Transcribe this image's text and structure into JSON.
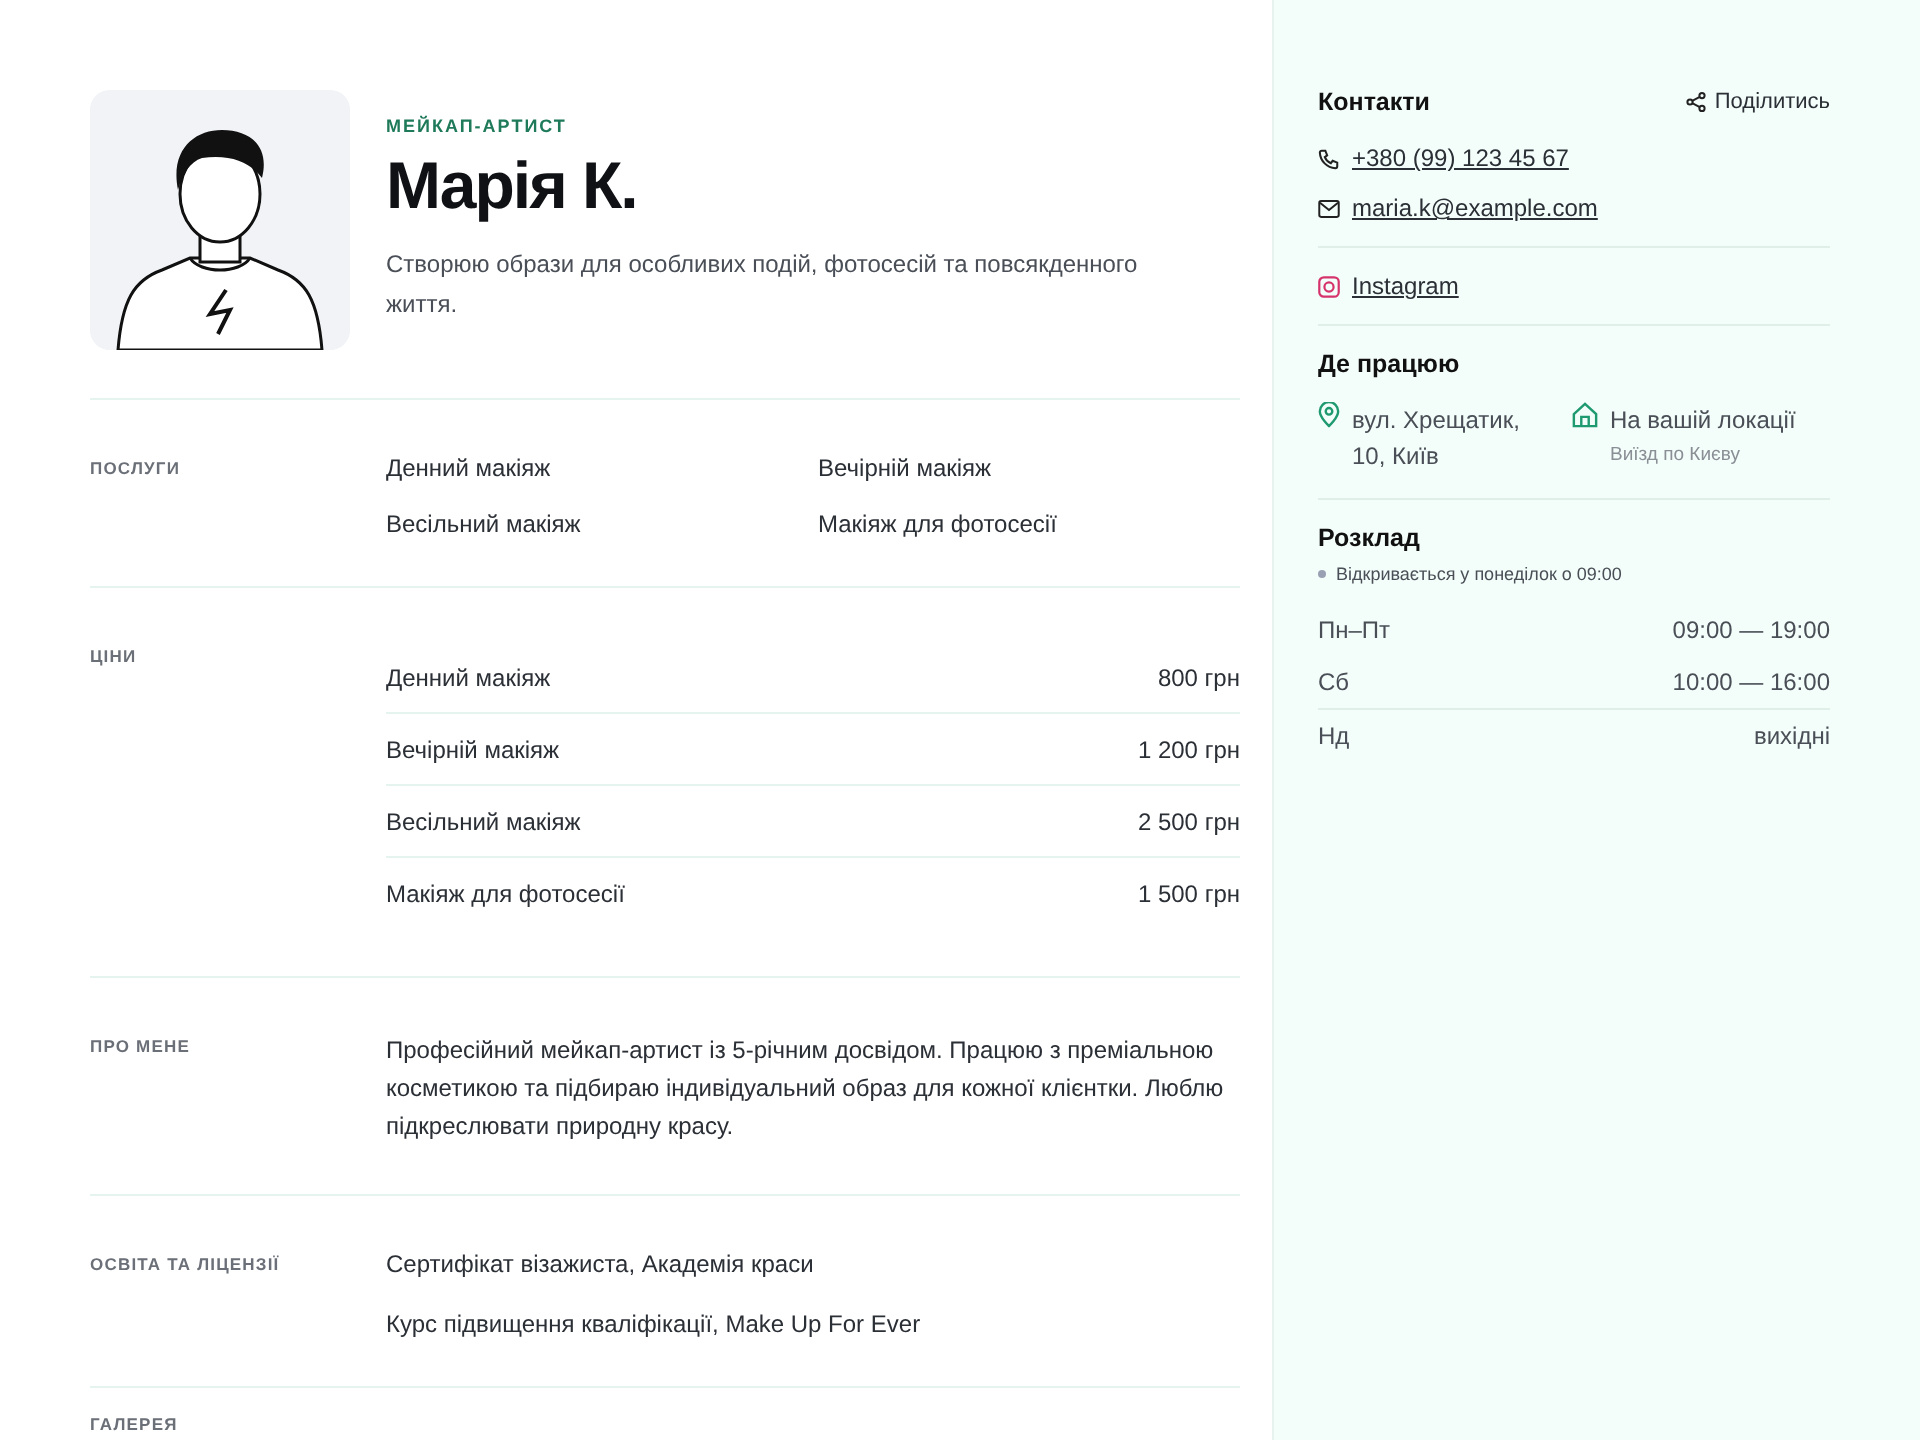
{
  "profile": {
    "role": "МЕЙКАП-АРТИСТ",
    "name": "Марія К.",
    "tagline": "Створюю образи для особливих подій, фотосесій та повсякденного життя."
  },
  "sections": [
    {
      "kind": "grid",
      "label": "ПОСЛУГИ",
      "items": [
        "Денний макіяж",
        "Вечірній макіяж",
        "Весільний макіяж",
        "Макіяж для фотосесії"
      ]
    },
    {
      "kind": "prices",
      "label": "ЦІНИ",
      "rows": [
        {
          "name": "Денний макіяж",
          "price": "800 грн"
        },
        {
          "name": "Вечірній макіяж",
          "price": "1 200 грн"
        },
        {
          "name": "Весільний макіяж",
          "price": "2 500 грн"
        },
        {
          "name": "Макіяж для фотосесії",
          "price": "1 500 грн"
        }
      ]
    },
    {
      "kind": "text",
      "label": "ПРО МЕНЕ",
      "text": "Професійний мейкап-артист із 5-річним досвідом. Працюю з преміальною косметикою та підбираю індивідуальний образ для кожної клієнтки. Люблю підкреслювати природну красу."
    },
    {
      "kind": "list",
      "label": "ОСВІТА ТА ЛІЦЕНЗІЇ",
      "items": [
        "Сертифікат візажиста, Академія краси",
        "Курс підвищення кваліфікації, Make Up For Ever"
      ]
    },
    {
      "kind": "list",
      "label": "ГАЛЕРЕЯ"
    }
  ],
  "sidebar": {
    "contacts_title": "Контакти",
    "share": "Поділитись",
    "contacts": [
      {
        "kind": "phone",
        "text": "+380 (99) 123 45 67"
      },
      {
        "kind": "email",
        "text": "maria.k@example.com"
      },
      {
        "kind": "instagram",
        "text": "Instagram"
      }
    ],
    "work_title": "Де працюю",
    "locations": [
      {
        "kind": "address",
        "text": "вул. Хрещатик, 10, Київ"
      },
      {
        "kind": "home",
        "text": "На вашій локації",
        "note": "Виїзд по Києву"
      }
    ],
    "schedule_title": "Розклад",
    "open": false,
    "status": "Відкривається у понеділок о 09:00",
    "schedule": [
      {
        "day": "Пн–Пт",
        "hours": "09:00 — 19:00"
      },
      {
        "day": "Сб",
        "hours": "10:00 — 16:00"
      },
      {
        "day": "Нд",
        "hours": "вихідні"
      }
    ]
  }
}
